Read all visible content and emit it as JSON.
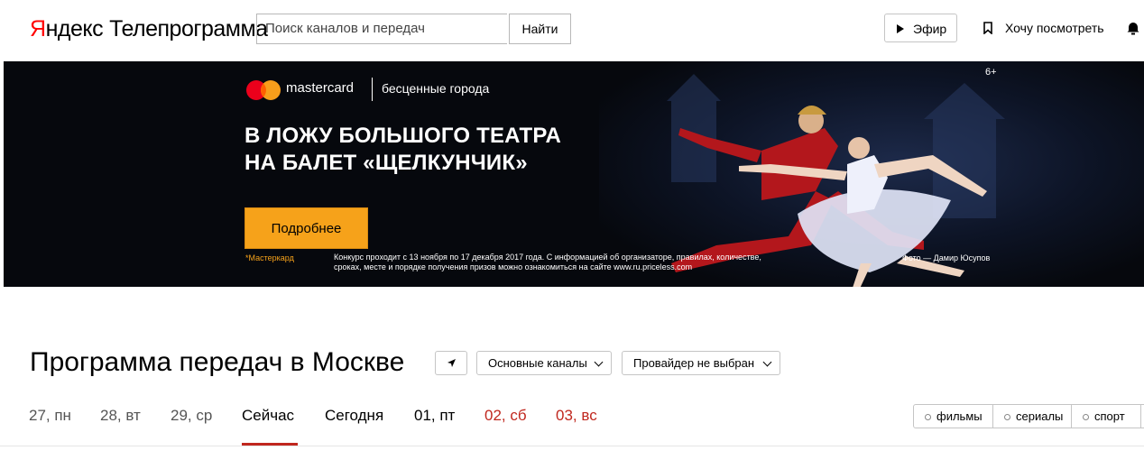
{
  "header": {
    "logo_yandex_first": "Я",
    "logo_yandex_rest": "ндекс",
    "logo_service": "Телепрограмма",
    "search_placeholder": "Поиск каналов и передач",
    "search_button": "Найти",
    "air_button": "Эфир",
    "watchlist_label": "Хочу посмотреть"
  },
  "banner": {
    "brand": "mastercard",
    "tagline": "бесценные города",
    "age_rating": "6+",
    "headline": [
      "В ЛОЖУ БОЛЬШОГО ТЕАТРА",
      "НА БАЛЕТ «ЩЕЛКУНЧИК»"
    ],
    "cta": "Подробнее",
    "footnote": "*Мастеркард",
    "contest_text": [
      "Конкурс проходит с 13 ноября по 17 декабря 2017 года. С информацией об организаторе, правилах, количестве,",
      "сроках, месте и порядке получения призов можно ознакомиться на сайте www.ru.priceless.com"
    ],
    "photo_credit": "Фото — Дамир Юсупов"
  },
  "main": {
    "title": "Программа передач в Москве",
    "channels_dropdown": "Основные каналы",
    "provider_dropdown": "Провайдер не выбран",
    "days": [
      {
        "label": "27, пн"
      },
      {
        "label": "28, вт"
      },
      {
        "label": "29, ср"
      },
      {
        "label": "Сейчас"
      },
      {
        "label": "Сегодня"
      },
      {
        "label": "01, пт"
      },
      {
        "label": "02, сб"
      },
      {
        "label": "03, вс"
      }
    ],
    "active_day": "Сейчас",
    "filters": [
      "фильмы",
      "сериалы",
      "спорт"
    ]
  },
  "colors": {
    "yandex_red": "#ff0000",
    "accent_red": "#c0271e",
    "cta_orange": "#f6a21a",
    "banner_bg": "#06080d"
  }
}
